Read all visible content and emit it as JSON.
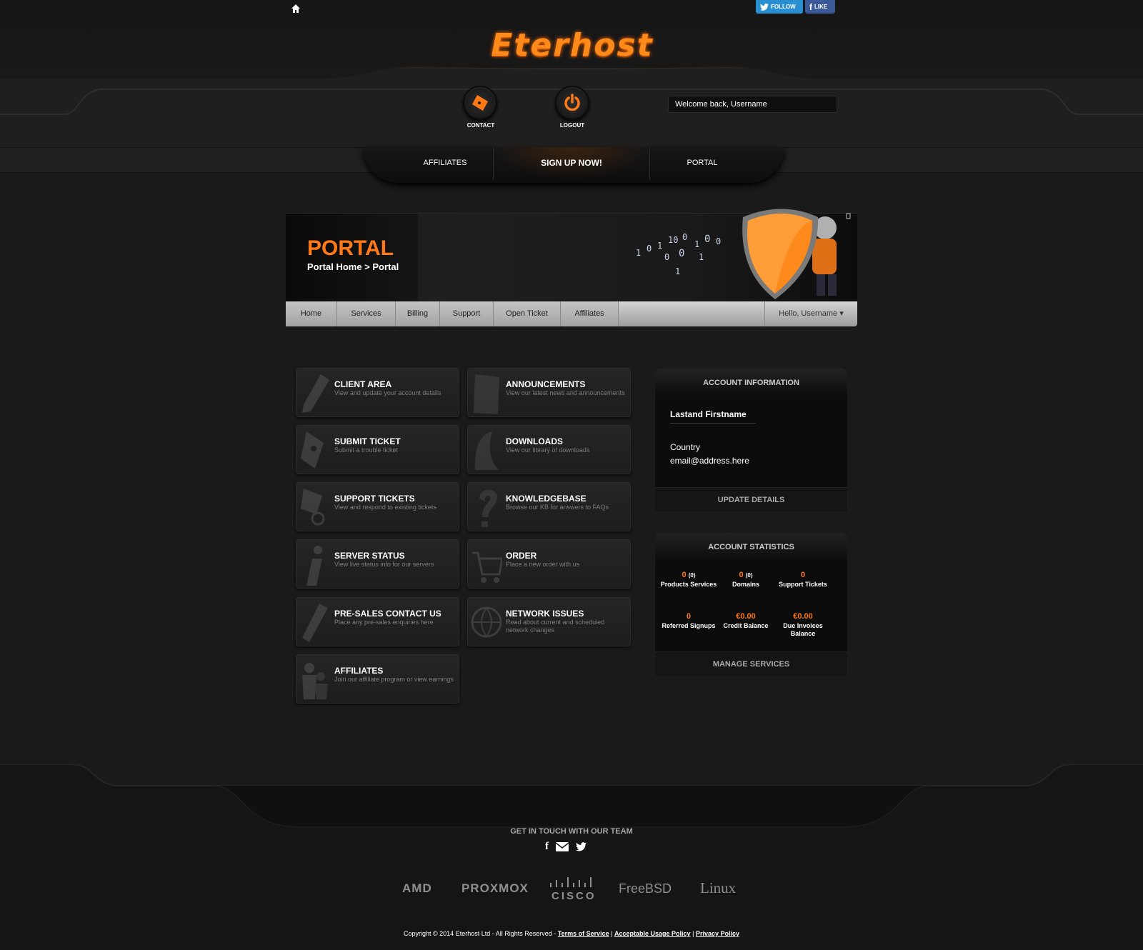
{
  "header": {
    "logo_text": "Eterhost",
    "social": {
      "follow": "FOLLOW",
      "like": "LIKE"
    },
    "contact_label": "CONTACT",
    "logout_label": "LOGOUT",
    "welcome": "Welcome back, Username"
  },
  "nav": {
    "affiliates": "AFFILIATES",
    "signup": "SIGN UP NOW!",
    "portal": "PORTAL"
  },
  "banner": {
    "title": "PORTAL",
    "breadcrumb": "Portal Home > Portal"
  },
  "subnav": {
    "items": [
      "Home",
      "Services",
      "Billing",
      "Support",
      "Open Ticket",
      "Affiliates"
    ],
    "hello": "Hello, Username ▾"
  },
  "tiles": [
    {
      "title": "CLIENT AREA",
      "desc": "View and update your account details",
      "icon": "pencil-icon"
    },
    {
      "title": "ANNOUNCEMENTS",
      "desc": "View our latest news and announcements",
      "icon": "newspaper-icon"
    },
    {
      "title": "SUBMIT TICKET",
      "desc": "Submit a trouble ticket",
      "icon": "ticket-icon"
    },
    {
      "title": "DOWNLOADS",
      "desc": "View our library of downloads",
      "icon": "download-icon"
    },
    {
      "title": "SUPPORT TICKETS",
      "desc": "View and respond to existing tickets",
      "icon": "ticket-search-icon"
    },
    {
      "title": "KNOWLEDGEBASE",
      "desc": "Browse our KB for answers to FAQs",
      "icon": "question-icon"
    },
    {
      "title": "SERVER STATUS",
      "desc": "View live status info for our servers",
      "icon": "info-icon"
    },
    {
      "title": "ORDER",
      "desc": "Place a new order with us",
      "icon": "cart-icon"
    },
    {
      "title": "PRE-SALES CONTACT US",
      "desc": "Place any pre-sales enquiries here",
      "icon": "pen-icon"
    },
    {
      "title": "NETWORK ISSUES",
      "desc": "Read about current and scheduled network changes",
      "icon": "globe-icon"
    },
    {
      "title": "AFFILIATES",
      "desc": "Join our affiliate program or view earnings",
      "icon": "users-icon"
    }
  ],
  "account": {
    "heading": "ACCOUNT INFORMATION",
    "name": "Lastand Firstname",
    "country": "Country",
    "email": "email@address.here",
    "update": "UPDATE DETAILS"
  },
  "stats": {
    "heading": "ACCOUNT STATISTICS",
    "items": [
      {
        "value": "0",
        "sub": "(0)",
        "label": "Products Services"
      },
      {
        "value": "0",
        "sub": "(0)",
        "label": "Domains"
      },
      {
        "value": "0",
        "sub": "",
        "label": "Support Tickets"
      },
      {
        "value": "0",
        "sub": "",
        "label": "Referred Signups"
      },
      {
        "value": "€0.00",
        "sub": "",
        "label": "Credit Balance"
      },
      {
        "value": "€0.00",
        "sub": "",
        "label": "Due Invoices Balance"
      }
    ],
    "manage": "MANAGE SERVICES"
  },
  "footer": {
    "get_in_touch": "GET IN TOUCH WITH OUR TEAM",
    "brands": [
      "AMD",
      "PROXMOX",
      "CISCO",
      "FreeBSD",
      "Linux"
    ],
    "copyright": "Copyright © 2014 Eterhost Ltd - All Rights Reserved -",
    "links": [
      "Terms of Service",
      "Acceptable Usage Policy",
      "Privacy Policy"
    ],
    "separator": "|"
  },
  "colors": {
    "accent": "#ff7a16",
    "background": "#1a1a1a",
    "panel": "#0c0c0c"
  }
}
